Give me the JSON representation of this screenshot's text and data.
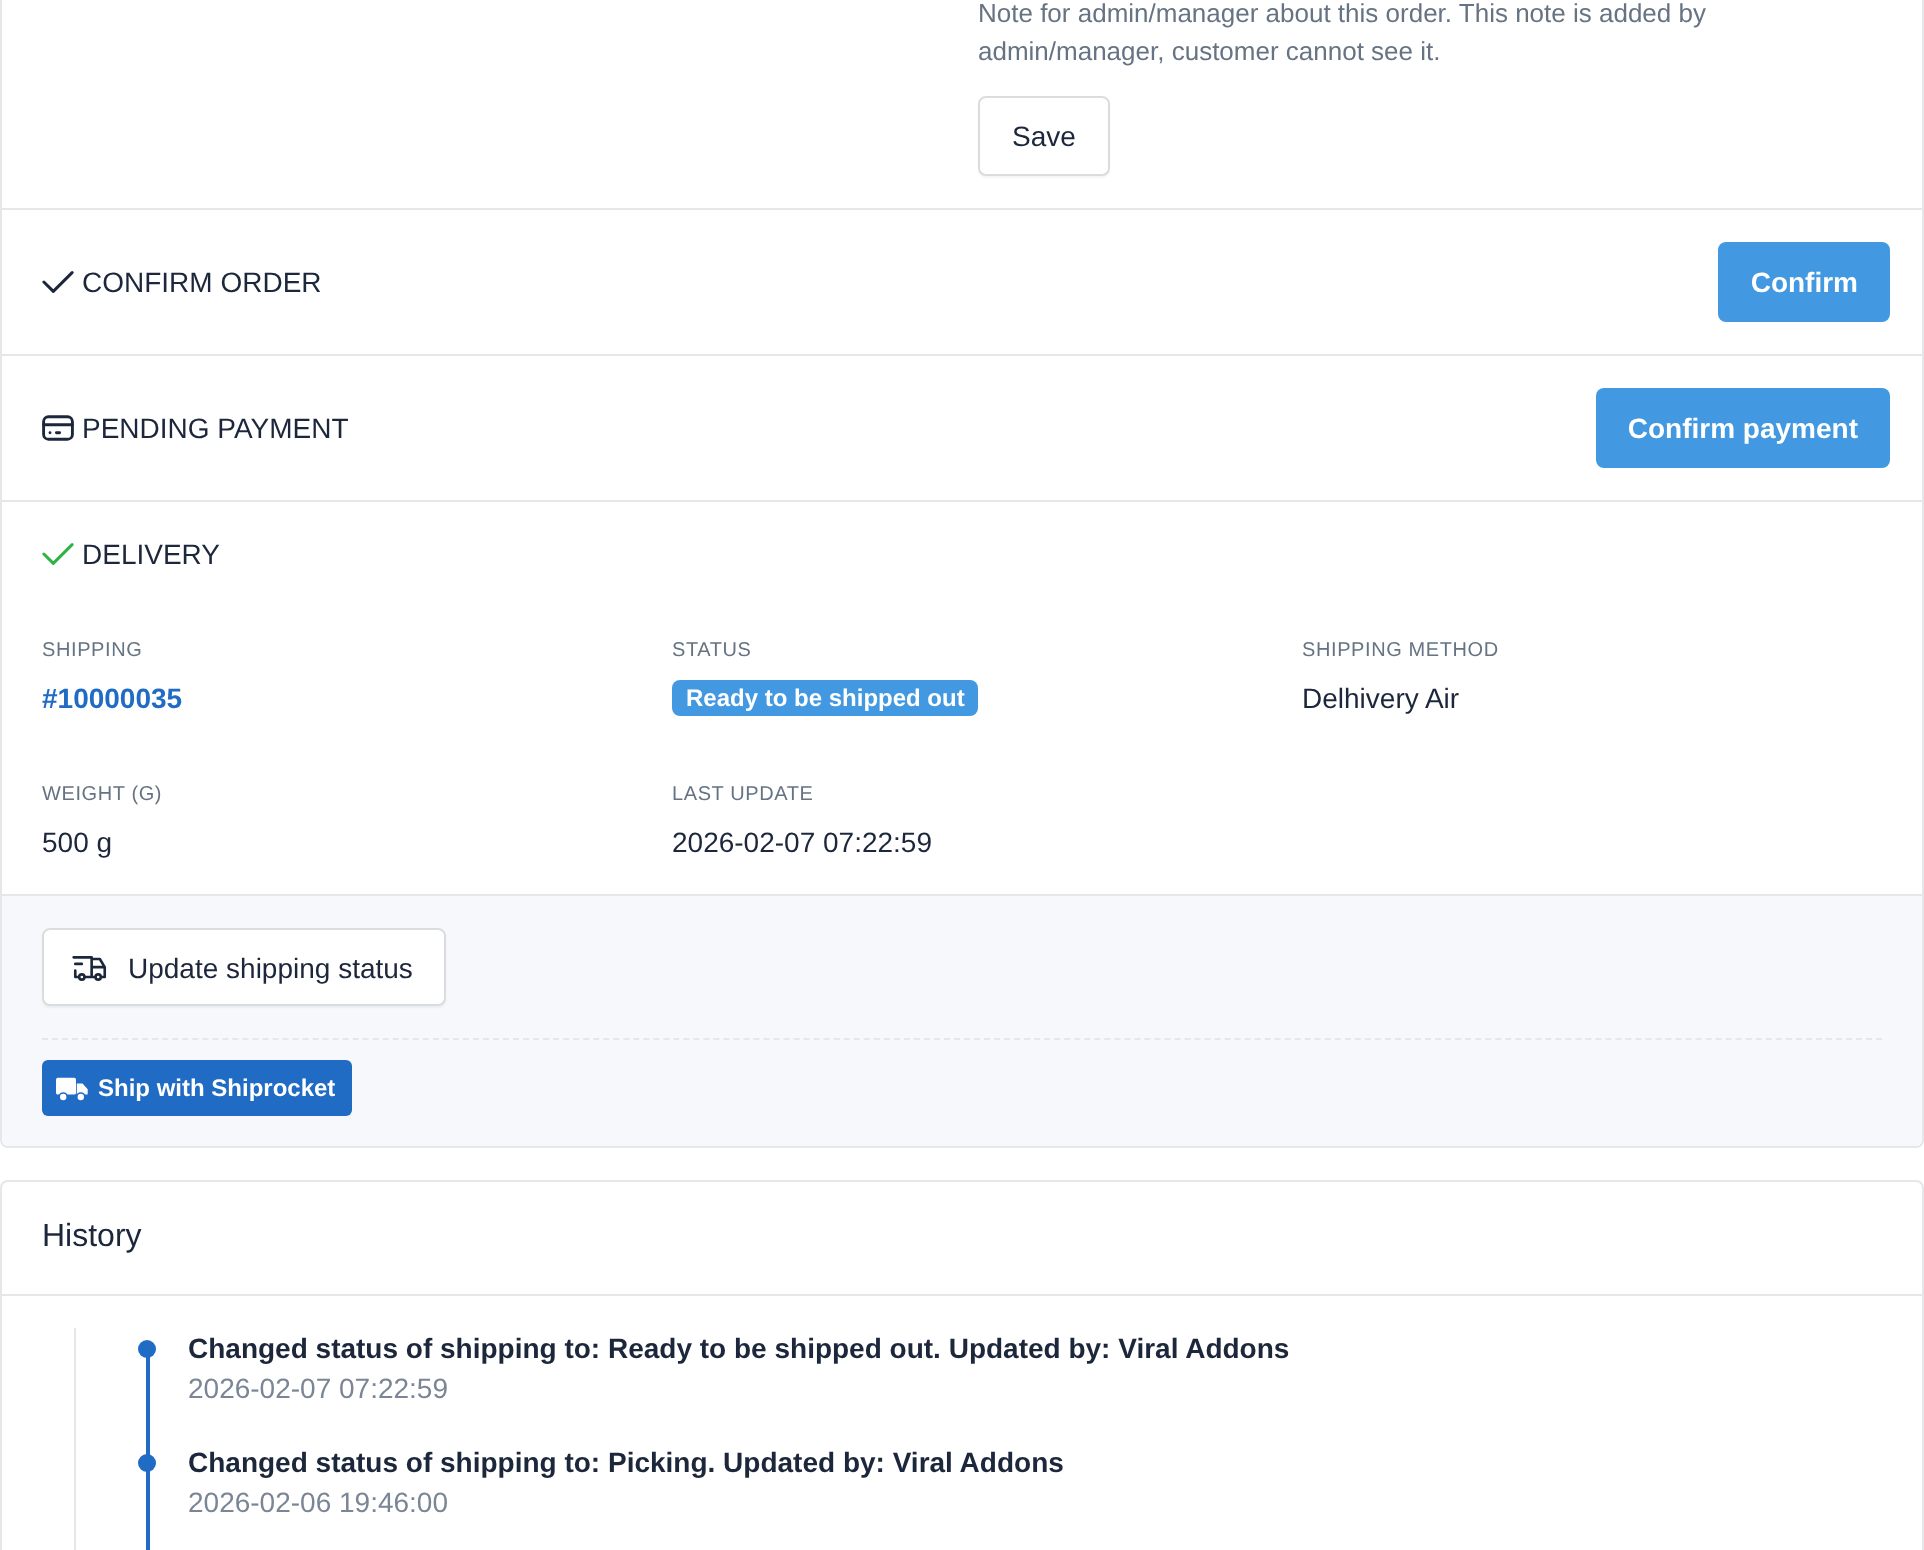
{
  "note_section": {
    "note": "Note for admin/manager about this order. This note is added by admin/manager, customer cannot see it.",
    "save_button": "Save"
  },
  "order_steps": [
    {
      "kind": "order",
      "title": "CONFIRM ORDER",
      "completed": false,
      "button": "Confirm"
    },
    {
      "kind": "payment",
      "title": "PENDING PAYMENT",
      "completed": false,
      "button": "Confirm payment"
    }
  ],
  "delivery": {
    "title": "DELIVERY",
    "completed": true,
    "fields": [
      {
        "kind": "link",
        "label": "SHIPPING",
        "value": "#10000035"
      },
      {
        "kind": "badge",
        "label": "STATUS",
        "value": "Ready to be shipped out"
      },
      {
        "kind": "text",
        "label": "SHIPPING METHOD",
        "value": "Delhivery Air"
      },
      {
        "kind": "text",
        "label": "WEIGHT (G)",
        "value": "500 g"
      },
      {
        "kind": "text",
        "label": "LAST UPDATE",
        "value": "2026-02-07 07:22:59"
      }
    ],
    "update_button": "Update shipping status",
    "shiprocket_button": "Ship with Shiprocket"
  },
  "history": {
    "title": "History",
    "entries": [
      {
        "text": "Changed status of shipping to: Ready to be shipped out. Updated by: Viral Addons",
        "time": "2026-02-07 07:22:59"
      },
      {
        "text": "Changed status of shipping to: Picking. Updated by: Viral Addons",
        "time": "2026-02-06 19:46:00"
      }
    ]
  }
}
